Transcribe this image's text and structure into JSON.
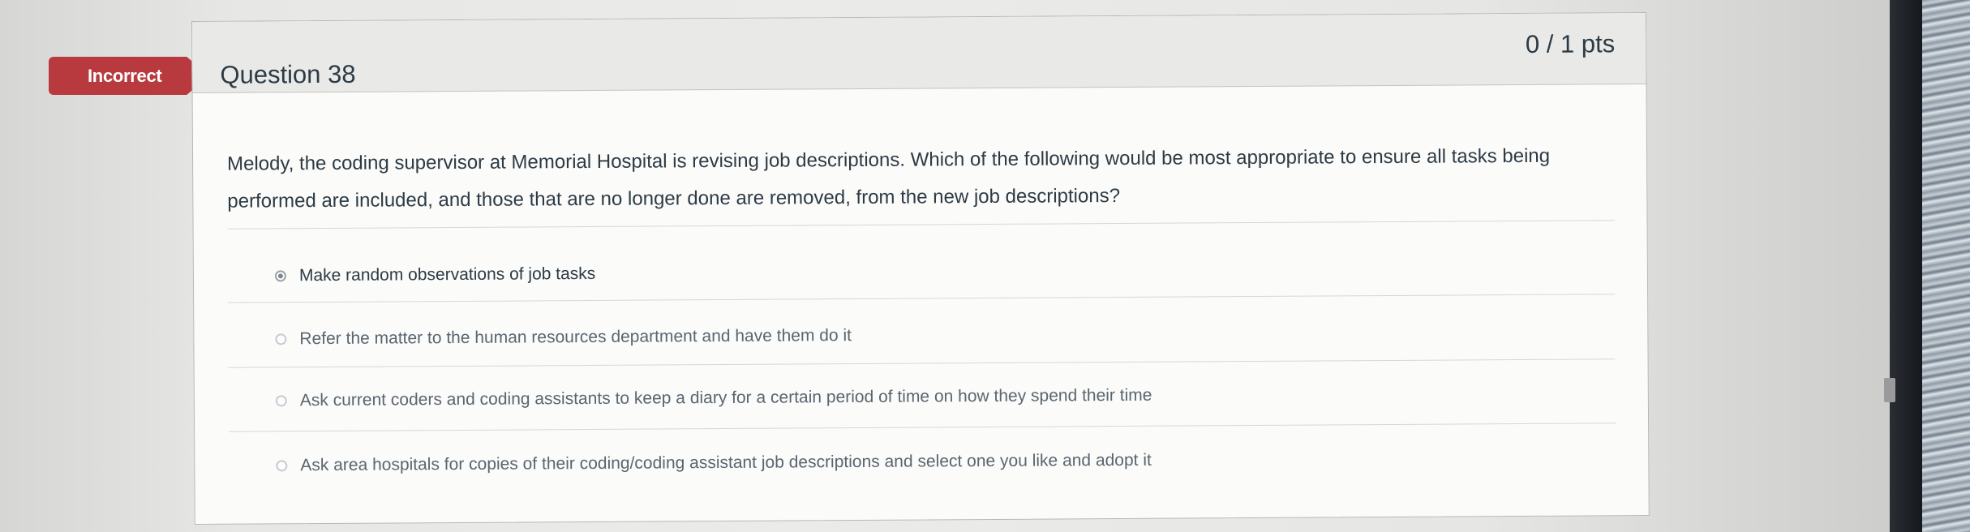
{
  "status_flag": {
    "label": "Incorrect",
    "color": "#b83a3f"
  },
  "question": {
    "title": "Question 38",
    "points": "0 / 1 pts",
    "text": "Melody, the coding supervisor at Memorial Hospital is revising job descriptions. Which of the following would be most appropriate to ensure all tasks being performed are included, and those that are no longer done are removed, from the new job descriptions?",
    "answers": [
      {
        "label": "Make random observations of job tasks",
        "selected": true
      },
      {
        "label": "Refer the matter to the human resources department and have them do it",
        "selected": false
      },
      {
        "label": "Ask current coders and coding assistants to keep a diary for a certain period of time on how they spend their time",
        "selected": false
      },
      {
        "label": "Ask area hospitals for copies of their coding/coding assistant job descriptions and select one you like and adopt it",
        "selected": false
      }
    ]
  }
}
